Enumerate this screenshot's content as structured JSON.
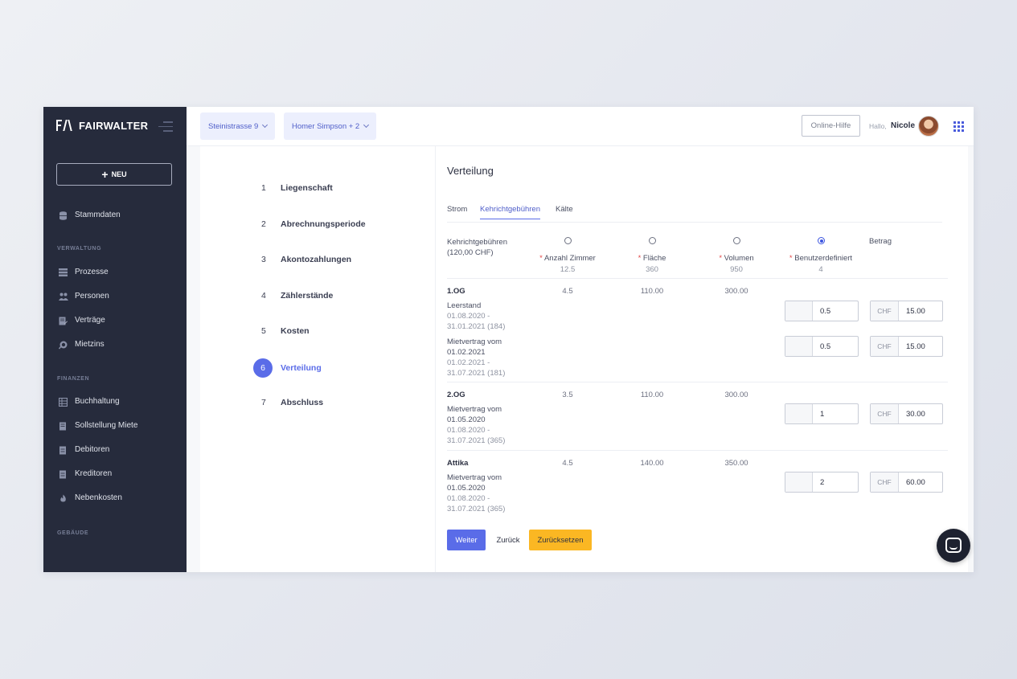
{
  "brand": {
    "name": "FAIRWALTER"
  },
  "sidebar": {
    "new_button": "NEU",
    "items_top": [
      {
        "label": "Stammdaten",
        "icon": "database-icon"
      }
    ],
    "section_verwaltung": "VERWALTUNG",
    "items_verwaltung": [
      {
        "label": "Prozesse",
        "icon": "list-icon"
      },
      {
        "label": "Personen",
        "icon": "people-icon"
      },
      {
        "label": "Verträge",
        "icon": "contract-icon"
      },
      {
        "label": "Mietzins",
        "icon": "coins-icon"
      }
    ],
    "section_finanzen": "FINANZEN",
    "items_finanzen": [
      {
        "label": "Buchhaltung",
        "icon": "ledger-icon"
      },
      {
        "label": "Sollstellung Miete",
        "icon": "invoice-icon"
      },
      {
        "label": "Debitoren",
        "icon": "debtor-icon"
      },
      {
        "label": "Kreditoren",
        "icon": "creditor-icon"
      },
      {
        "label": "Nebenkosten",
        "icon": "flame-icon"
      }
    ],
    "section_gebaeude": "GEBÄUDE"
  },
  "header": {
    "property_chip": "Steinistrasse 9",
    "person_chip": "Homer Simpson + 2",
    "help_button": "Online-Hilfe",
    "greeting": "Hallo,",
    "user_name": "Nicole"
  },
  "steps": [
    {
      "num": "1",
      "label": "Liegenschaft"
    },
    {
      "num": "2",
      "label": "Abrechnungsperiode"
    },
    {
      "num": "3",
      "label": "Akontozahlungen"
    },
    {
      "num": "4",
      "label": "Zählerstände"
    },
    {
      "num": "5",
      "label": "Kosten"
    },
    {
      "num": "6",
      "label": "Verteilung"
    },
    {
      "num": "7",
      "label": "Abschluss"
    }
  ],
  "panel": {
    "title": "Verteilung",
    "tabs": [
      "Strom",
      "Kehrichtgebühren",
      "Kälte"
    ],
    "active_tab": 1,
    "head_label_1": "Kehrichtgebühren",
    "head_label_2": "(120,00 CHF)",
    "columns": [
      {
        "label": "Anzahl Zimmer",
        "total": "12.5"
      },
      {
        "label": "Fläche",
        "total": "360"
      },
      {
        "label": "Volumen",
        "total": "950"
      },
      {
        "label": "Benutzerdefiniert",
        "total": "4"
      }
    ],
    "selected_column": 3,
    "amount_header": "Betrag",
    "currency": "CHF",
    "units": [
      {
        "name": "1.OG",
        "zimmer": "4.5",
        "flaeche": "110.00",
        "volumen": "300.00",
        "entries": [
          {
            "title": "Leerstand",
            "line2": "01.08.2020 -",
            "line3": "31.01.2021 (184)",
            "line4": "",
            "value": "0.5",
            "amount": "15.00"
          },
          {
            "title": "Mietvertrag vom",
            "line2": "01.02.2021",
            "line3": "01.02.2021 -",
            "line4": "31.07.2021 (181)",
            "value": "0.5",
            "amount": "15.00"
          }
        ]
      },
      {
        "name": "2.OG",
        "zimmer": "3.5",
        "flaeche": "110.00",
        "volumen": "300.00",
        "entries": [
          {
            "title": "Mietvertrag vom",
            "line2": "01.05.2020",
            "line3": "01.08.2020 -",
            "line4": "31.07.2021 (365)",
            "value": "1",
            "amount": "30.00"
          }
        ]
      },
      {
        "name": "Attika",
        "zimmer": "4.5",
        "flaeche": "140.00",
        "volumen": "350.00",
        "entries": [
          {
            "title": "Mietvertrag vom",
            "line2": "01.05.2020",
            "line3": "01.08.2020 -",
            "line4": "31.07.2021 (365)",
            "value": "2",
            "amount": "60.00"
          }
        ]
      }
    ],
    "buttons": {
      "next": "Weiter",
      "back": "Zurück",
      "reset": "Zurücksetzen"
    }
  },
  "colors": {
    "accent": "#5a6ce8",
    "sidebar": "#262b3c",
    "warning": "#fbb723"
  }
}
